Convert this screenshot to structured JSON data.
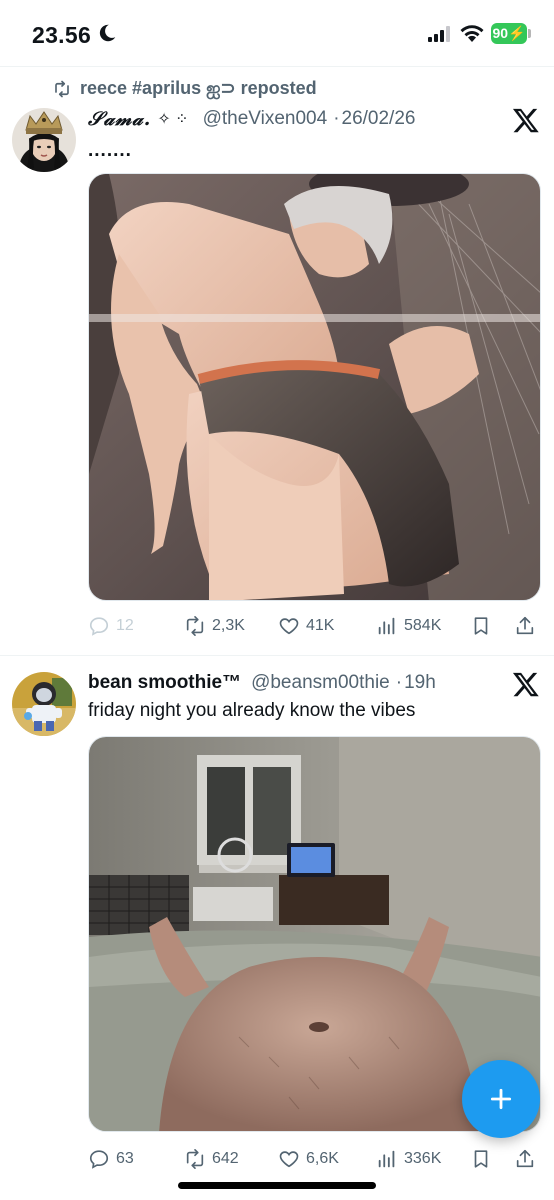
{
  "status_bar": {
    "time": "23.56",
    "battery": "90"
  },
  "tweets": [
    {
      "repost_by": "reece #aprilus ஐ⊃ reposted",
      "name": "𝒮𝒶𝓂𝒶.",
      "sparkle": "✧ ⁘",
      "handle": "@theVixen004",
      "date": "26/02/26",
      "text": ".......",
      "replies": "12",
      "reposts": "2,3K",
      "likes": "41K",
      "views": "584K"
    },
    {
      "name": "bean smoothie™",
      "handle": "@beansm00thie",
      "date": "19h",
      "text": "friday night you already know the vibes",
      "replies": "63",
      "reposts": "642",
      "likes": "6,6K",
      "views": "336K"
    }
  ],
  "colors": {
    "accent": "#1d9bf0",
    "muted": "#536471",
    "battery": "#34c759"
  }
}
